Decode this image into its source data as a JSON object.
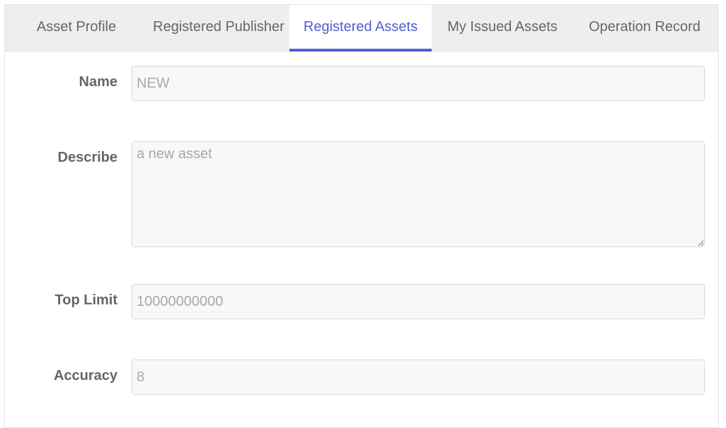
{
  "tabs": [
    {
      "label": "Asset Profile",
      "active": false
    },
    {
      "label": "Registered Publisher",
      "active": false
    },
    {
      "label": "Registered Assets",
      "active": true
    },
    {
      "label": "My Issued Assets",
      "active": false
    },
    {
      "label": "Operation Record",
      "active": false
    }
  ],
  "form": {
    "name": {
      "label": "Name",
      "placeholder": "NEW"
    },
    "describe": {
      "label": "Describe",
      "placeholder": "a new asset"
    },
    "top_limit": {
      "label": "Top Limit",
      "placeholder": "10000000000"
    },
    "accuracy": {
      "label": "Accuracy",
      "placeholder": "8"
    }
  },
  "colors": {
    "accent": "#4f5fd1",
    "tab_bar_bg": "#eeeeee",
    "field_bg": "#f8f8f8",
    "label_text": "#666666"
  }
}
